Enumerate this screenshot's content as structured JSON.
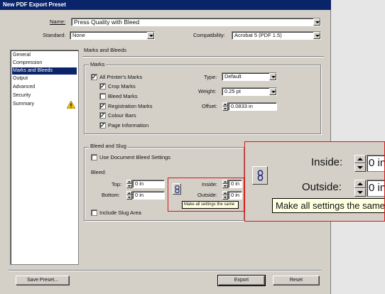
{
  "window": {
    "title": "New PDF Export Preset"
  },
  "top": {
    "name_label": "Name:",
    "name_value": "Press Quality with Bleed",
    "standard_label": "Standard:",
    "standard_value": "None",
    "compatibility_label": "Compatibility:",
    "compatibility_value": "Acrobat 5 (PDF 1.5)"
  },
  "sidebar": {
    "items": [
      {
        "label": "General"
      },
      {
        "label": "Compression"
      },
      {
        "label": "Marks and Bleeds",
        "selected": true
      },
      {
        "label": "Output"
      },
      {
        "label": "Advanced"
      },
      {
        "label": "Security"
      },
      {
        "label": "Summary"
      }
    ]
  },
  "panel": {
    "title": "Marks and Bleeds",
    "marks": {
      "group_title": "Marks",
      "all_printers_marks": {
        "label": "All Printer's Marks",
        "checked": true
      },
      "crop_marks": {
        "label": "Crop Marks",
        "checked": true
      },
      "bleed_marks": {
        "label": "Bleed Marks",
        "checked": false
      },
      "registration_marks": {
        "label": "Registration Marks",
        "checked": true
      },
      "colour_bars": {
        "label": "Colour Bars",
        "checked": true
      },
      "page_information": {
        "label": "Page Information",
        "checked": true
      },
      "type_label": "Type:",
      "type_value": "Default",
      "weight_label": "Weight:",
      "weight_value": "0.25 pt",
      "offset_label": "Offset:",
      "offset_value": "0.0833 in"
    },
    "bleed": {
      "group_title": "Bleed and Slug",
      "use_document_bleed": {
        "label": "Use Document Bleed Settings",
        "checked": false
      },
      "bleed_label": "Bleed:",
      "top_label": "Top:",
      "top_value": "0 in",
      "bottom_label": "Bottom:",
      "bottom_value": "0 in",
      "inside_label": "Inside:",
      "inside_value": "0 in",
      "outside_label": "Outside:",
      "outside_value": "0 in",
      "include_slug": {
        "label": "Include Slug Area",
        "checked": false
      },
      "tooltip": "Make all settings the same"
    }
  },
  "buttons": {
    "save_preset": "Save Preset...",
    "export": "Export",
    "reset": "Reset"
  },
  "zoom": {
    "inside_label": "Inside:",
    "inside_value": "0 in",
    "outside_label": "Outside:",
    "outside_value": "0 in",
    "tooltip": "Make all settings the same"
  },
  "colors": {
    "titlebar": "#0a246a",
    "highlight": "#d81818",
    "warning": "#e8c000"
  }
}
